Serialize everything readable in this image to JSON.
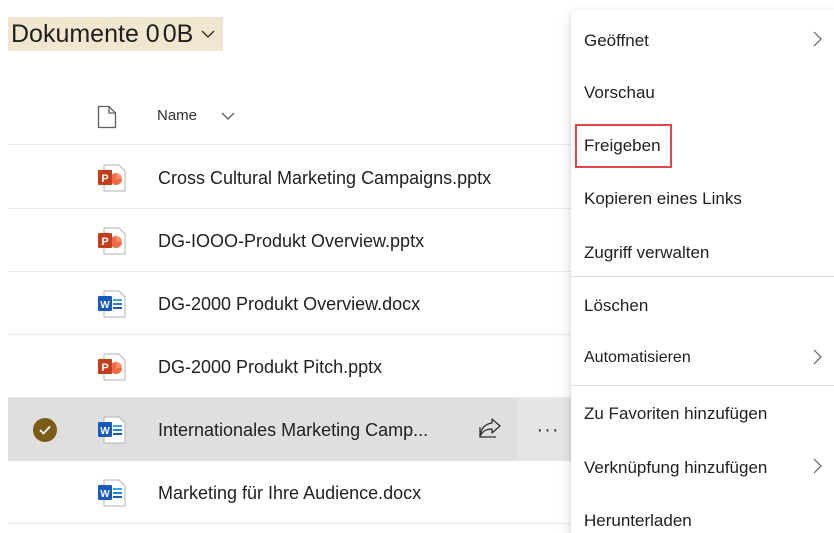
{
  "library": {
    "title_part1": "Dokumente 0",
    "title_part2": "0B"
  },
  "header": {
    "name_label": "Name",
    "file_icon": "file-icon",
    "sort_icon": "chevron-down-icon"
  },
  "files": [
    {
      "name": "Cross Cultural Marketing Campaigns.pptx",
      "type": "pptx",
      "selected": false
    },
    {
      "name": "DG-IOOO-Produkt Overview.pptx",
      "type": "pptx",
      "selected": false
    },
    {
      "name": "DG-2000 Produkt Overview.docx",
      "type": "docx",
      "selected": false
    },
    {
      "name": "DG-2000 Produkt Pitch.pptx",
      "type": "pptx",
      "selected": false
    },
    {
      "name": "Internationales Marketing Camp...",
      "type": "docx",
      "selected": true
    },
    {
      "name": "Marketing für Ihre Audience.docx",
      "type": "docx",
      "selected": false
    }
  ],
  "row_actions": {
    "share_icon": "share-icon",
    "more_label": "···"
  },
  "context_menu": {
    "items": [
      {
        "label": "Geöffnet",
        "submenu": true
      },
      {
        "label": "Vorschau",
        "submenu": false
      },
      {
        "label": "Freigeben",
        "submenu": false,
        "highlighted": true
      },
      {
        "label": "Kopieren eines Links",
        "submenu": false
      },
      {
        "label": "Zugriff verwalten",
        "submenu": false
      },
      {
        "label": "Löschen",
        "submenu": false
      },
      {
        "label": "Automatisieren",
        "submenu": true
      },
      {
        "label": "Zu Favoriten hinzufügen",
        "submenu": false
      },
      {
        "label": "Verknüpfung hinzufügen",
        "submenu": true
      },
      {
        "label": "Herunterladen",
        "submenu": false
      }
    ]
  },
  "colors": {
    "title_highlight": "#f1e6cf",
    "selected_check": "#7a5c17",
    "selected_row": "#e1dfdd",
    "highlight_box": "#e0474c",
    "powerpoint": "#c43e1c",
    "word": "#185abd"
  }
}
